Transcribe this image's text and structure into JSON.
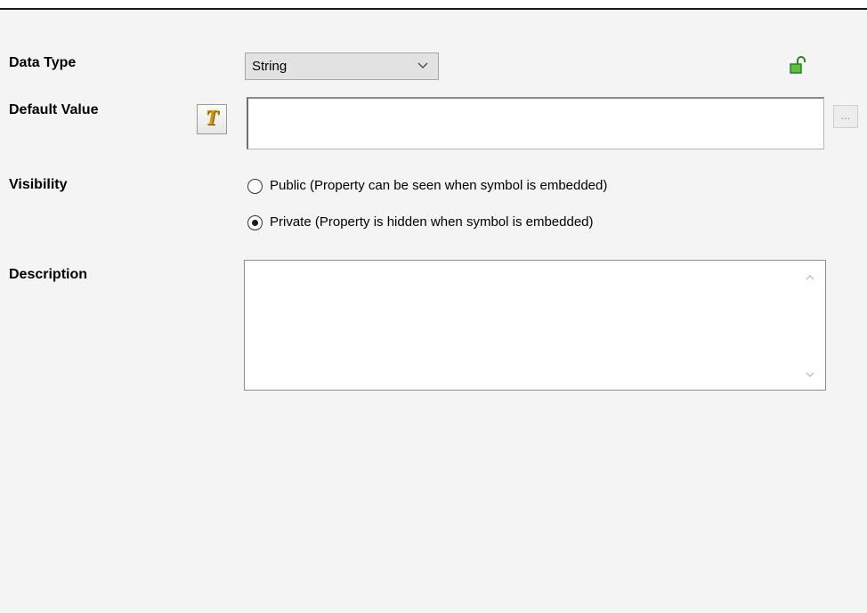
{
  "fields": {
    "data_type": {
      "label": "Data Type",
      "selected": "String"
    },
    "default_value": {
      "label": "Default Value",
      "value": "",
      "format_icon": "text-format-icon",
      "browse_label": "..."
    },
    "visibility": {
      "label": "Visibility",
      "options": [
        {
          "label": "Public (Property can be seen when symbol is embedded)",
          "selected": false
        },
        {
          "label": "Private (Property is hidden when symbol is embedded)",
          "selected": true
        }
      ]
    },
    "description": {
      "label": "Description",
      "value": ""
    }
  },
  "icons": {
    "lock": "unlocked-padlock-icon",
    "format": "text-format-icon",
    "dropdown": "chevron-down-icon",
    "scroll_up": "chevron-up-icon",
    "scroll_down": "chevron-down-icon"
  },
  "colors": {
    "panel_bg": "#f4f4f4",
    "lock_green": "#3a9a2a",
    "format_gold": "#d49a00"
  }
}
